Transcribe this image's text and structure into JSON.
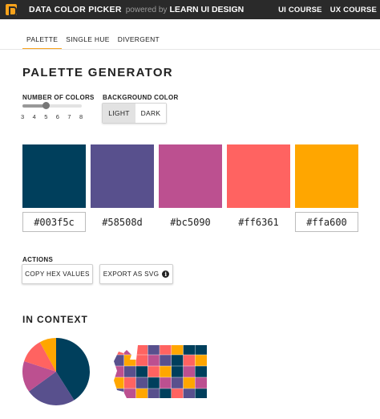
{
  "header": {
    "app_title": "DATA COLOR PICKER",
    "powered_by": "powered by",
    "brand": "LEARN UI DESIGN",
    "links": [
      "UI COURSE",
      "UX COURSE"
    ]
  },
  "tabs": [
    {
      "label": "PALETTE",
      "active": true
    },
    {
      "label": "SINGLE HUE",
      "active": false
    },
    {
      "label": "DIVERGENT",
      "active": false
    }
  ],
  "page_title": "PALETTE GENERATOR",
  "number_of_colors": {
    "label": "NUMBER OF COLORS",
    "ticks": [
      "3",
      "4",
      "5",
      "6",
      "7",
      "8"
    ],
    "value": 5
  },
  "background_color": {
    "label": "BACKGROUND COLOR",
    "options": [
      "LIGHT",
      "DARK"
    ],
    "selected": "LIGHT"
  },
  "palette": [
    {
      "color": "#003f5c",
      "hex": "#003f5c"
    },
    {
      "color": "#58508d",
      "hex": "#58508d"
    },
    {
      "color": "#bc5090",
      "hex": "#bc5090"
    },
    {
      "color": "#ff6361",
      "hex": "#ff6361"
    },
    {
      "color": "#ffa600",
      "hex": "#ffa600"
    }
  ],
  "actions": {
    "label": "ACTIONS",
    "copy_hex": "COPY HEX VALUES",
    "export_svg": "EXPORT AS SVG",
    "info_icon": "i"
  },
  "context": {
    "title": "IN CONTEXT",
    "pie_shares": [
      0.41,
      0.24,
      0.15,
      0.12,
      0.08
    ],
    "map_icon": "washington-state-map"
  },
  "colors": {
    "header_bg": "#2a2a2a",
    "accent": "#f7a21b"
  }
}
